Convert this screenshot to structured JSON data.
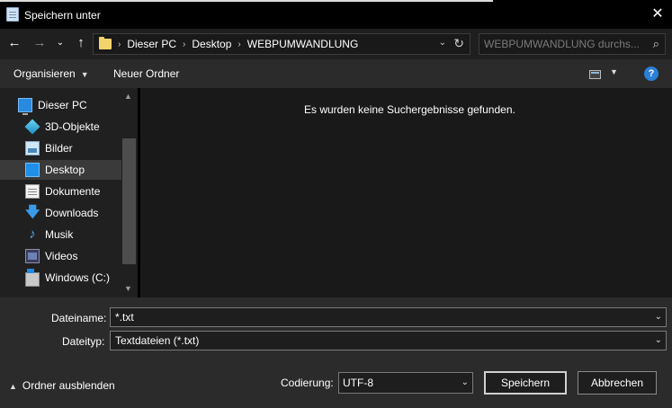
{
  "window": {
    "title": "Speichern unter",
    "close_glyph": "✕"
  },
  "nav": {
    "back_glyph": "←",
    "forward_glyph": "→",
    "recent_glyph": "⌄",
    "up_glyph": "↑"
  },
  "breadcrumb": {
    "items": [
      "Dieser PC",
      "Desktop",
      "WEBPUMWANDLUNG"
    ],
    "separator": "›",
    "dropdown_glyph": "⌄",
    "refresh_glyph": "↻"
  },
  "search": {
    "placeholder": "WEBPUMWANDLUNG durchs...",
    "icon_glyph": "⌕"
  },
  "toolbar": {
    "organize_label": "Organisieren",
    "new_folder_label": "Neuer Ordner",
    "help_glyph": "?"
  },
  "sidebar": {
    "items": [
      {
        "label": "Dieser PC",
        "icon": "computer-icon"
      },
      {
        "label": "3D-Objekte",
        "icon": "3d-objects-icon"
      },
      {
        "label": "Bilder",
        "icon": "pictures-icon"
      },
      {
        "label": "Desktop",
        "icon": "desktop-icon",
        "selected": true
      },
      {
        "label": "Dokumente",
        "icon": "documents-icon"
      },
      {
        "label": "Downloads",
        "icon": "downloads-icon"
      },
      {
        "label": "Musik",
        "icon": "music-icon"
      },
      {
        "label": "Videos",
        "icon": "videos-icon"
      },
      {
        "label": "Windows (C:)",
        "icon": "drive-icon"
      }
    ]
  },
  "content": {
    "empty_message": "Es wurden keine Suchergebnisse gefunden."
  },
  "form": {
    "filename_label": "Dateiname:",
    "filename_value": "*.txt",
    "filetype_label": "Dateityp:",
    "filetype_value": "Textdateien (*.txt)",
    "encoding_label": "Codierung:",
    "encoding_value": "UTF-8",
    "save_label": "Speichern",
    "cancel_label": "Abbrechen",
    "hide_folders_label": "Ordner ausblenden"
  },
  "colors": {
    "accent": "#2b7fd6",
    "folder": "#f3d36b",
    "selection": "#3a3a3a"
  }
}
